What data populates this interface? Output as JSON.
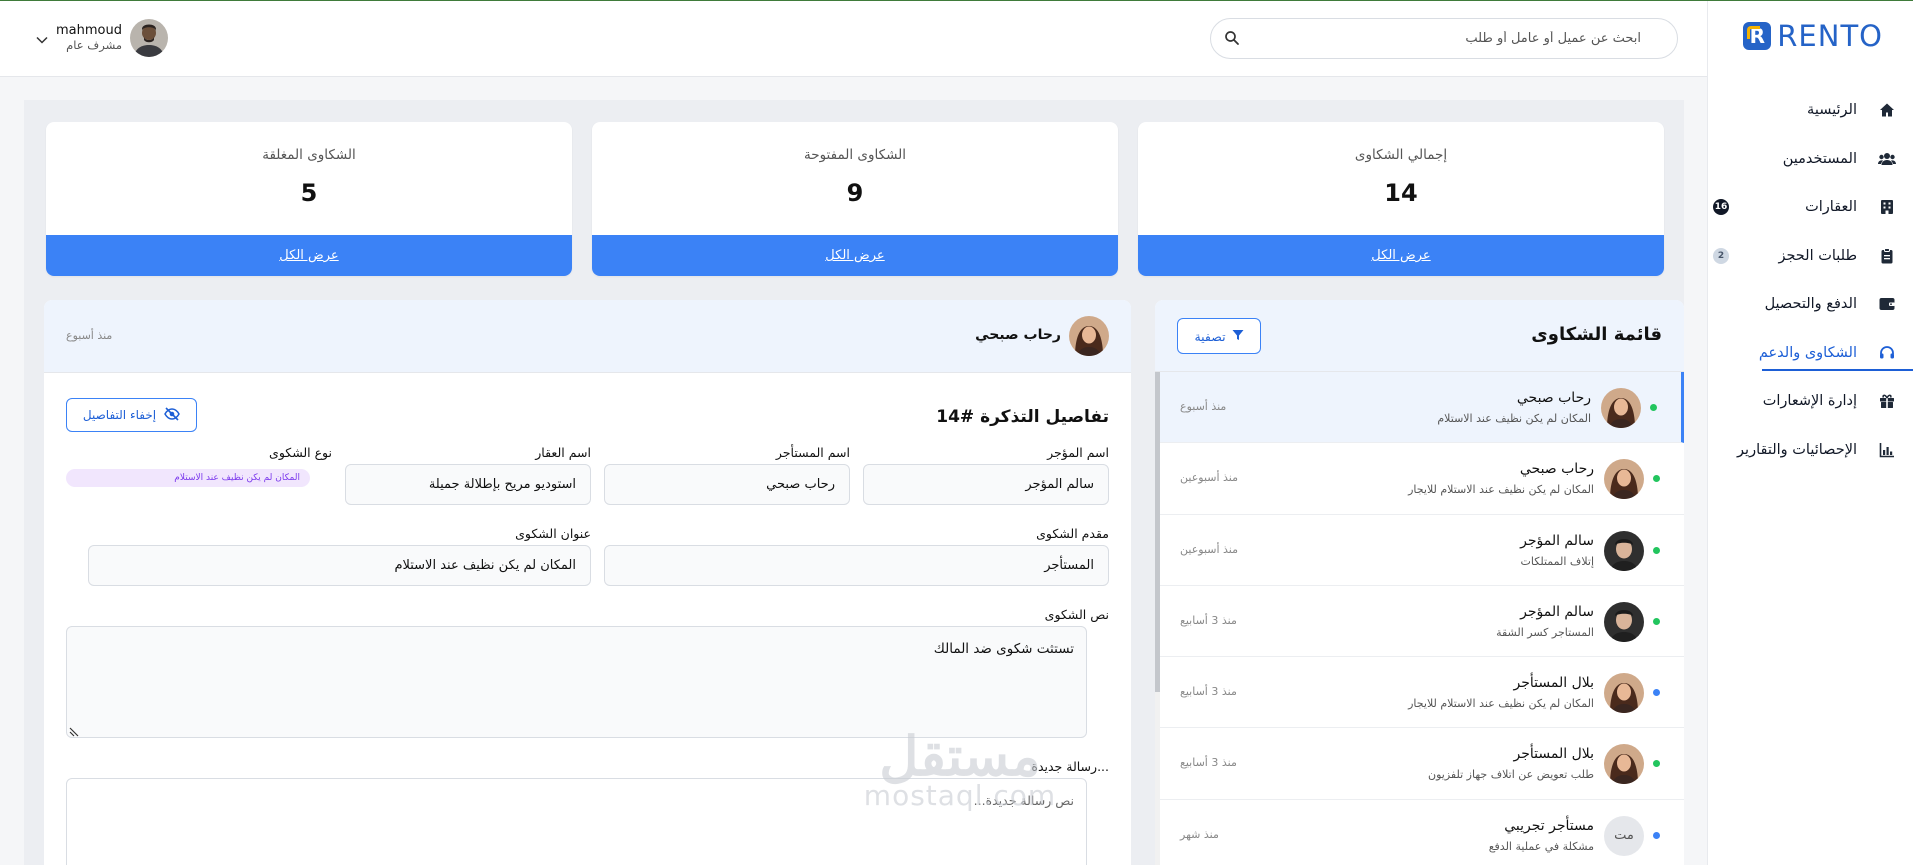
{
  "brand": {
    "name": "RENTO",
    "mark": "R",
    "primary_color": "#2563c7",
    "accent_color": "#3b82f6"
  },
  "sidebar": {
    "items": [
      {
        "label": "الرئيسية",
        "icon": "home-icon",
        "badge": ""
      },
      {
        "label": "المستخدمين",
        "icon": "users-icon",
        "badge": ""
      },
      {
        "label": "العقارات",
        "icon": "building-icon",
        "badge": "16"
      },
      {
        "label": "طلبات الحجز",
        "icon": "clipboard-icon",
        "badge": "2"
      },
      {
        "label": "الدفع والتحصيل",
        "icon": "wallet-icon",
        "badge": ""
      },
      {
        "label": "الشكاوى والدعم",
        "icon": "headset-icon",
        "badge": "",
        "active": true
      },
      {
        "label": "إدارة الإشعارات",
        "icon": "gift-icon",
        "badge": ""
      },
      {
        "label": "الإحصائيات والتقارير",
        "icon": "chart-icon",
        "badge": ""
      }
    ]
  },
  "header": {
    "search_placeholder": "ابحث عن عميل أو عامل أو طلب",
    "user": {
      "name": "mahmoud",
      "role": "مشرف عام"
    }
  },
  "stats": [
    {
      "title": "إجمالي الشكاوى",
      "value": "14",
      "button": "عرض الكل"
    },
    {
      "title": "الشكاوى المفتوحة",
      "value": "9",
      "button": "عرض الكل"
    },
    {
      "title": "الشكاوى المغلقة",
      "value": "5",
      "button": "عرض الكل"
    }
  ],
  "complaints": {
    "title": "قائمة الشكاوى",
    "filter_label": "تصفية",
    "items": [
      {
        "name": "رحاب صبحي",
        "subject": "المكان لم يكن نظيف عند الاستلام",
        "time": "منذ أسبوع",
        "status_color": "#22c55e",
        "avatar": "photo-woman"
      },
      {
        "name": "رحاب صبحي",
        "subject": "المكان لم يكن نظيف عند الاستلام للايجار",
        "time": "منذ أسبوعين",
        "status_color": "#22c55e",
        "avatar": "photo-woman"
      },
      {
        "name": "سالم المؤجر",
        "subject": "إتلاف الممتلكات",
        "time": "منذ أسبوعين",
        "status_color": "#22c55e",
        "avatar": "photo-man"
      },
      {
        "name": "سالم المؤجر",
        "subject": "المستاجر كسر الشقة",
        "time": "منذ 3 أسابيع",
        "status_color": "#22c55e",
        "avatar": "photo-man"
      },
      {
        "name": "بلال المستأجر",
        "subject": "المكان لم يكن نظيف عند الاستلام للايجار",
        "time": "منذ 3 أسابيع",
        "status_color": "#3b82f6",
        "avatar": "photo-woman"
      },
      {
        "name": "بلال المستأجر",
        "subject": "طلب تعويض عن اتلاف جهاز تلفزيون",
        "time": "منذ 3 أسابيع",
        "status_color": "#22c55e",
        "avatar": "photo-woman"
      },
      {
        "name": "مستأجر تجريبي",
        "subject": "مشكلة في عملية الدفع",
        "time": "منذ شهر",
        "status_color": "#3b82f6",
        "avatar": "initials",
        "initials": "مت"
      }
    ]
  },
  "detail": {
    "name": "رحاب صبحي",
    "time": "منذ أسبوع",
    "ticket_title": "تفاصيل التذكرة #14",
    "hide_label": "إخفاء التفاصيل",
    "fields": {
      "owner_label": "اسم المؤجر",
      "owner_value": "سالم المؤجر",
      "tenant_label": "اسم المستأجر",
      "tenant_value": "رحاب صبحي",
      "property_label": "اسم العقار",
      "property_value": "استوديو مريح بإطلالة جميلة",
      "type_label": "نوع الشكوى",
      "type_value": "المكان لم يكن نظيف عند الاستلام",
      "submitter_label": "مقدم الشكوى",
      "submitter_value": "المستأجر",
      "subject_label": "عنوان الشكوى",
      "subject_value": "المكان لم يكن نظيف عند الاستلام",
      "text_label": "نص الشكوى",
      "text_value": "تستثت شكوى ضد المالك",
      "message_label": "رسالة جديدة...",
      "message_placeholder": "نص رسالة جديدة..."
    }
  },
  "watermark": {
    "line1": "مستقل",
    "line2": "mostaql.com"
  }
}
